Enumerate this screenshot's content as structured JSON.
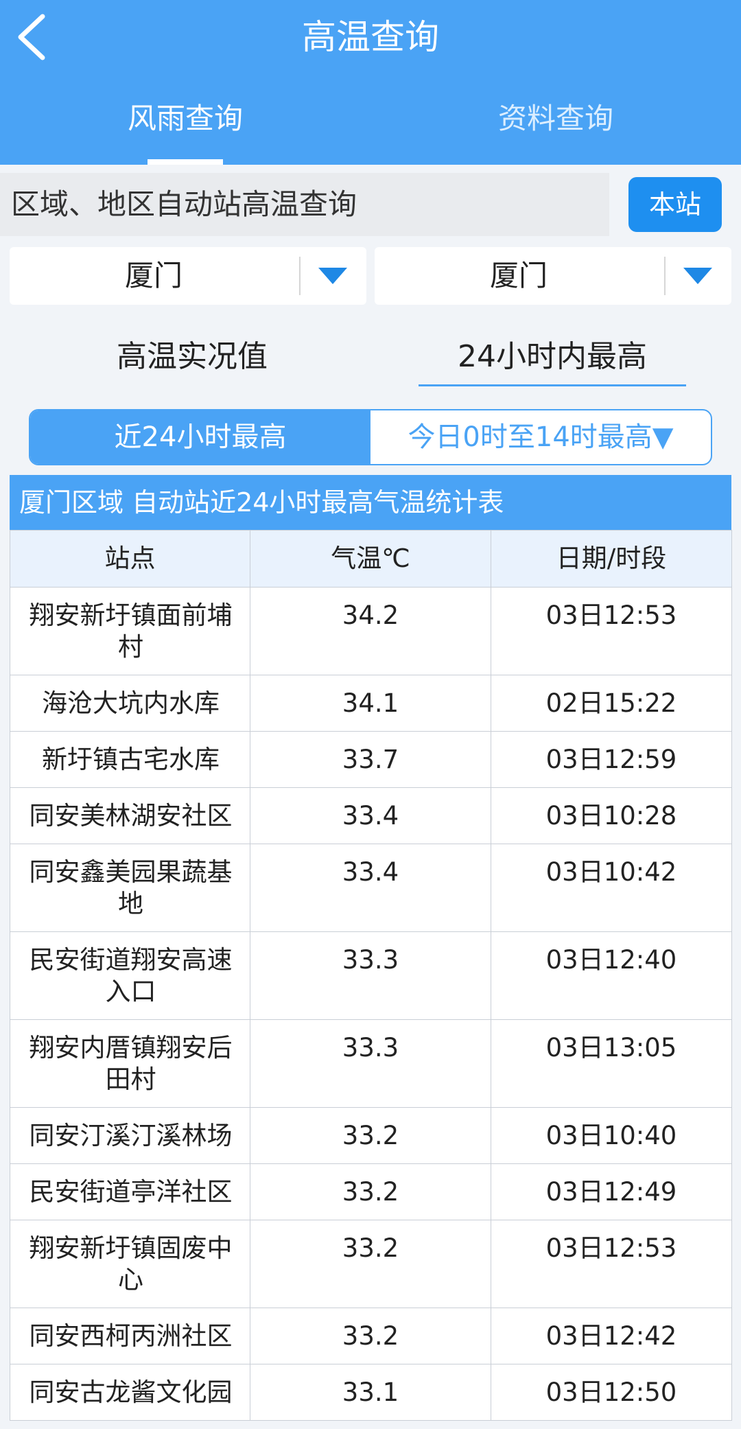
{
  "header": {
    "title": "高温查询",
    "tabs": [
      {
        "label": "风雨查询",
        "active": true
      },
      {
        "label": "资料查询",
        "active": false
      }
    ]
  },
  "query": {
    "search_text": "区域、地区自动站高温查询",
    "station_button": "本站"
  },
  "selects": {
    "region": "厦门",
    "area": "厦门"
  },
  "modes": {
    "current": "高温实况值",
    "max_24h": "24小时内最高"
  },
  "segments": {
    "last_24h": "近24小时最高",
    "today": "今日0时至14时最高▼"
  },
  "table": {
    "title": "厦门区域 自动站近24小时最高气温统计表",
    "headers": [
      "站点",
      "气温℃",
      "日期/时段"
    ],
    "rows": [
      {
        "station": "翔安新圩镇面前埔村",
        "temp": "34.2",
        "time": "03日12:53",
        "lines": 2
      },
      {
        "station": "海沧大坑内水库",
        "temp": "34.1",
        "time": "02日15:22",
        "lines": 1
      },
      {
        "station": "新圩镇古宅水库",
        "temp": "33.7",
        "time": "03日12:59",
        "lines": 1
      },
      {
        "station": "同安美林湖安社区",
        "temp": "33.4",
        "time": "03日10:28",
        "lines": 1
      },
      {
        "station": "同安鑫美园果蔬基地",
        "temp": "33.4",
        "time": "03日10:42",
        "lines": 2
      },
      {
        "station": "民安街道翔安高速入口",
        "temp": "33.3",
        "time": "03日12:40",
        "lines": 2
      },
      {
        "station": "翔安内厝镇翔安后田村",
        "temp": "33.3",
        "time": "03日13:05",
        "lines": 2
      },
      {
        "station": "同安汀溪汀溪林场",
        "temp": "33.2",
        "time": "03日10:40",
        "lines": 1
      },
      {
        "station": "民安街道亭洋社区",
        "temp": "33.2",
        "time": "03日12:49",
        "lines": 1
      },
      {
        "station": "翔安新圩镇固废中心",
        "temp": "33.2",
        "time": "03日12:53",
        "lines": 2
      },
      {
        "station": "同安西柯丙洲社区",
        "temp": "33.2",
        "time": "03日12:42",
        "lines": 1
      },
      {
        "station": "同安古龙酱文化园",
        "temp": "33.1",
        "time": "03日12:50",
        "lines": 1
      }
    ]
  },
  "colors": {
    "header_blue": "#4aa3f5",
    "button_blue": "#1e8ff0",
    "header_row_bg": "#e9f2fd"
  }
}
